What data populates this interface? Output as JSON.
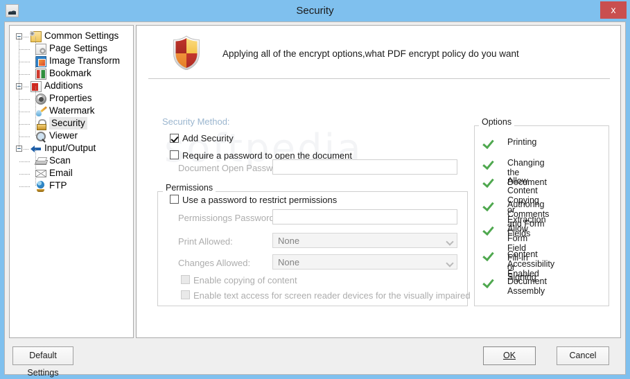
{
  "window": {
    "title": "Security",
    "app_icon": "app-icon",
    "close_label": "x"
  },
  "sidebar": {
    "items": [
      {
        "label": "Common Settings",
        "icon": "common-settings-icon",
        "level": 0,
        "expander": "minus",
        "selected": false
      },
      {
        "label": "Page Settings",
        "icon": "page-settings-icon",
        "level": 1,
        "expander": "",
        "selected": false
      },
      {
        "label": "Image Transform",
        "icon": "image-transform-icon",
        "level": 1,
        "expander": "",
        "selected": false
      },
      {
        "label": "Bookmark",
        "icon": "bookmark-icon",
        "level": 1,
        "expander": "",
        "selected": false
      },
      {
        "label": "Additions",
        "icon": "additions-icon",
        "level": 0,
        "expander": "minus",
        "selected": false
      },
      {
        "label": "Properties",
        "icon": "properties-icon",
        "level": 1,
        "expander": "",
        "selected": false
      },
      {
        "label": "Watermark",
        "icon": "watermark-icon",
        "level": 1,
        "expander": "",
        "selected": false
      },
      {
        "label": "Security",
        "icon": "security-lock-icon",
        "level": 1,
        "expander": "",
        "selected": true
      },
      {
        "label": "Viewer",
        "icon": "viewer-magnifier-icon",
        "level": 1,
        "expander": "",
        "selected": false
      },
      {
        "label": "Input/Output",
        "icon": "input-output-arrow-icon",
        "level": 0,
        "expander": "minus",
        "selected": false
      },
      {
        "label": "Scan",
        "icon": "scanner-icon",
        "level": 1,
        "expander": "",
        "selected": false
      },
      {
        "label": "Email",
        "icon": "email-envelope-icon",
        "level": 1,
        "expander": "",
        "selected": false
      },
      {
        "label": "FTP",
        "icon": "ftp-globe-icon",
        "level": 1,
        "expander": "",
        "selected": false
      }
    ]
  },
  "main": {
    "header_icon": "shield-icon",
    "header_text": "Applying all of the encrypt options,what PDF encrypt policy do you want",
    "watermark_text": "softpedia",
    "security_method": {
      "title": "Security Method:",
      "add_security": {
        "label": "Add Security",
        "checked": true
      },
      "require_password": {
        "label": "Require a password to open the document",
        "checked": false
      },
      "open_password": {
        "label": "Document Open Password",
        "value": "",
        "placeholder": ""
      }
    },
    "permissions": {
      "title": "Permissions",
      "use_password": {
        "label": "Use a password to restrict permissions",
        "checked": false
      },
      "permissions_password": {
        "label": "Permissiongs Password:",
        "value": "",
        "placeholder": ""
      },
      "print_allowed": {
        "label": "Print Allowed:",
        "value": "None"
      },
      "changes_allowed": {
        "label": "Changes Allowed:",
        "value": "None"
      },
      "enable_copying": {
        "label": "Enable copying of content",
        "checked": false
      },
      "enable_text_access": {
        "label": "Enable text access for screen reader devices for the visually impaired",
        "checked": false
      }
    },
    "options": {
      "title": "Options",
      "items": [
        {
          "label": "Printing",
          "check": true
        },
        {
          "label": "Changing the Document",
          "check": true
        },
        {
          "label": "Allow Content Copying\nor Extraction",
          "check": true
        },
        {
          "label": "Authoring Comments\nand Form Fields",
          "check": true
        },
        {
          "label": "Allow Form Field Fill-in\nor Signing",
          "check": true
        },
        {
          "label": "Content Accessibility\nEnabled",
          "check": true
        },
        {
          "label": "Document Assembly",
          "check": true
        }
      ]
    }
  },
  "footer": {
    "default_settings": "Default Settings",
    "ok": "OK",
    "cancel": "Cancel"
  },
  "colors": {
    "titlebar": "#7fc0ee",
    "close_button": "#c94f4f",
    "dialog_bg": "#efefef",
    "panel_bg": "#ffffff",
    "disabled_text": "#adadad",
    "section_label": "#9bb6cf",
    "check_green": "#4fa84f"
  }
}
